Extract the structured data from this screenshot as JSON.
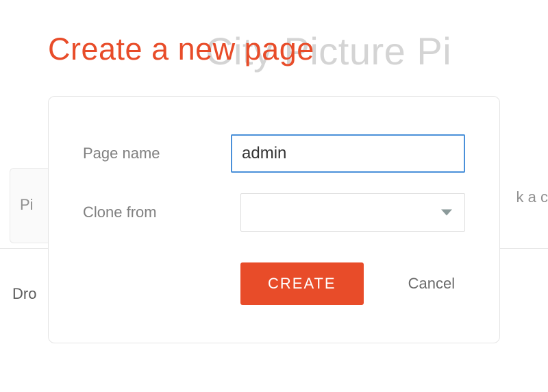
{
  "background": {
    "title": "City Picture Pi",
    "left_box_text": "Pi",
    "right_text": "k a c",
    "drop_text": "Dro"
  },
  "dialog": {
    "title": "Create a new page",
    "page_name_label": "Page name",
    "page_name_value": "admin",
    "clone_from_label": "Clone from",
    "clone_from_value": "",
    "create_label": "CREATE",
    "cancel_label": "Cancel"
  }
}
